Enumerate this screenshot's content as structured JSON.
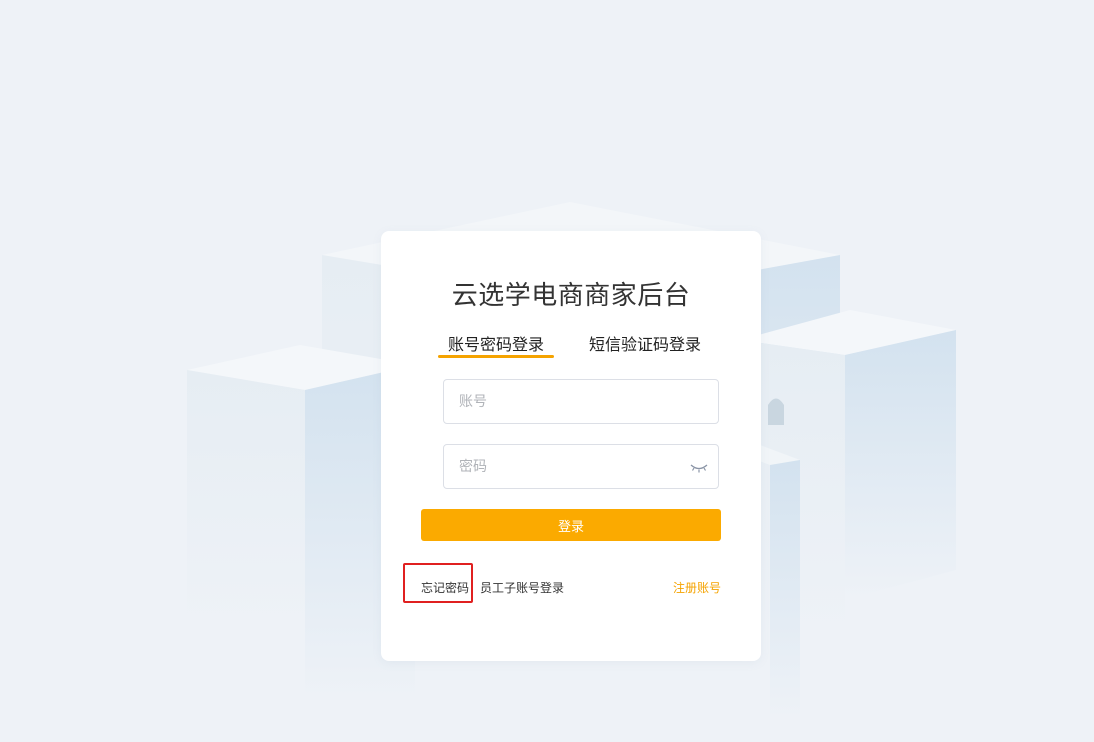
{
  "login": {
    "title": "云选学电商商家后台",
    "tabs": [
      {
        "label": "账号密码登录",
        "active": true
      },
      {
        "label": "短信验证码登录",
        "active": false
      }
    ],
    "account_placeholder": "账号",
    "password_placeholder": "密码",
    "submit_label": "登录",
    "forgot_password": "忘记密码",
    "staff_login": "员工子账号登录",
    "register": "注册账号"
  },
  "colors": {
    "accent": "#fbaa00",
    "background": "#eef2f7",
    "highlight": "#e02020"
  },
  "icons": {
    "password_toggle": "eye-closed-icon"
  }
}
